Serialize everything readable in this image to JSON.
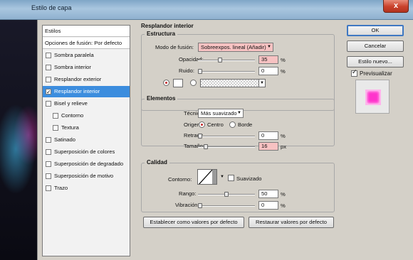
{
  "window": {
    "title": "Estilo de capa",
    "close_glyph": "x"
  },
  "styles_panel": {
    "header": "Estilos",
    "blend_options": "Opciones de fusión: Por defecto",
    "items": [
      {
        "label": "Sombra paralela",
        "checked": false
      },
      {
        "label": "Sombra interior",
        "checked": false
      },
      {
        "label": "Resplandor exterior",
        "checked": false
      },
      {
        "label": "Resplandor interior",
        "checked": true
      },
      {
        "label": "Bisel y relieve",
        "checked": false
      },
      {
        "label": "Contorno",
        "checked": false
      },
      {
        "label": "Textura",
        "checked": false
      },
      {
        "label": "Satinado",
        "checked": false
      },
      {
        "label": "Superposición de colores",
        "checked": false
      },
      {
        "label": "Superposición de degradado",
        "checked": false
      },
      {
        "label": "Superposición de motivo",
        "checked": false
      },
      {
        "label": "Trazo",
        "checked": false
      }
    ]
  },
  "main": {
    "title": "Resplandor interior",
    "estructura": {
      "label": "Estructura",
      "blend_mode_label": "Modo de fusión:",
      "blend_mode_value": "Sobreexpos. lineal (Añadir)",
      "opacity_label": "Opacidad:",
      "opacity_value": "35",
      "opacity_unit": "%",
      "noise_label": "Ruido:",
      "noise_value": "0",
      "noise_unit": "%"
    },
    "elementos": {
      "label": "Elementos",
      "technique_label": "Técnica:",
      "technique_value": "Más suavizado",
      "source_label": "Origen:",
      "source_center": "Centro",
      "source_edge": "Borde",
      "choke_label": "Retraer:",
      "choke_value": "0",
      "choke_unit": "%",
      "size_label": "Tamaño:",
      "size_value": "16",
      "size_unit": "px"
    },
    "calidad": {
      "label": "Calidad",
      "contour_label": "Contorno:",
      "antialias_label": "Suavizado",
      "range_label": "Rango:",
      "range_value": "50",
      "range_unit": "%",
      "jitter_label": "Vibración:",
      "jitter_value": "0",
      "jitter_unit": "%"
    },
    "set_default_btn": "Establecer como valores por defecto",
    "reset_default_btn": "Restaurar valores por defecto"
  },
  "right": {
    "ok": "OK",
    "cancel": "Cancelar",
    "new_style": "Estilo nuevo...",
    "preview_label": "Previsualizar",
    "preview_checked": true
  },
  "colors": {
    "selection": "#3c8dde",
    "highlight_field": "#f7c2c2",
    "preview_fill": "#ff33cc"
  }
}
